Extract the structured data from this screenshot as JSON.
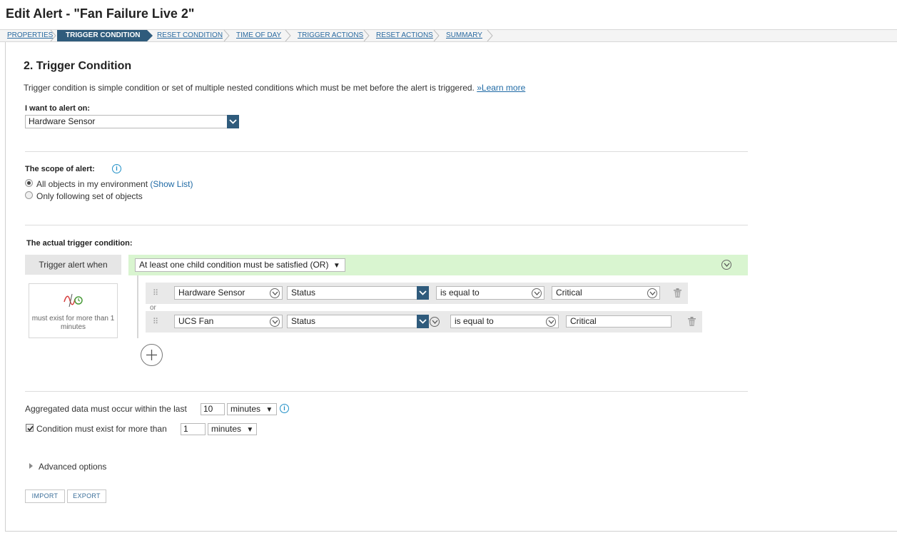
{
  "page": {
    "title": "Edit Alert - \"Fan Failure Live 2\""
  },
  "wizard": {
    "steps": [
      {
        "label": "PROPERTIES",
        "active": false
      },
      {
        "label": "TRIGGER CONDITION",
        "active": true
      },
      {
        "label": "RESET CONDITION",
        "active": false
      },
      {
        "label": "TIME OF DAY",
        "active": false
      },
      {
        "label": "TRIGGER ACTIONS",
        "active": false
      },
      {
        "label": "RESET ACTIONS",
        "active": false
      },
      {
        "label": "SUMMARY",
        "active": false
      }
    ]
  },
  "section": {
    "title": "2. Trigger Condition",
    "description": "Trigger condition is simple condition or set of multiple nested conditions which must be met before the alert is triggered.",
    "learn_more": "»Learn more"
  },
  "alert_on": {
    "label": "I want to alert on:",
    "value": "Hardware Sensor"
  },
  "scope": {
    "label": "The scope of alert:",
    "option_all": "All objects in my environment",
    "show_list": "(Show List)",
    "option_following": "Only following set of objects",
    "selected": "all"
  },
  "trigger": {
    "label": "The actual trigger condition:",
    "when_label": "Trigger alert when",
    "logic_value": "At least one child condition must be satisfied (OR)",
    "or_label": "or",
    "summary_text": "must exist for more than 1 minutes",
    "conditions": [
      {
        "object": "Hardware Sensor",
        "field": "Status",
        "operator": "is equal to",
        "value": "Critical"
      },
      {
        "object": "UCS Fan",
        "field": "Status",
        "operator": "is equal to",
        "value": "Critical"
      }
    ]
  },
  "aggregation": {
    "label": "Aggregated data must occur within the last",
    "value": "10",
    "unit": "minutes"
  },
  "exist": {
    "label": "Condition must exist for more than",
    "checked": true,
    "value": "1",
    "unit": "minutes"
  },
  "advanced": {
    "label": "Advanced options"
  },
  "buttons": {
    "import": "IMPORT",
    "export": "EXPORT"
  },
  "colors": {
    "accent": "#2f5b7c",
    "link": "#1f6aa5",
    "green_bar": "#d9f5d0",
    "info": "#1f8fc7"
  }
}
